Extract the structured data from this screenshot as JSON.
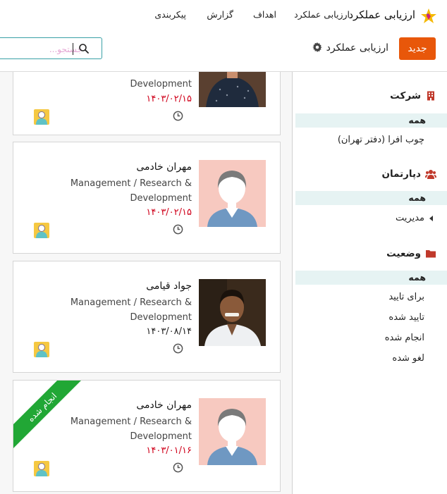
{
  "navbar": {
    "app_title": "ارزیابی عملکرد",
    "menu": [
      {
        "label": "ارزیابی عملکرد"
      },
      {
        "label": "اهداف"
      },
      {
        "label": "گزارش"
      },
      {
        "label": "پیکربندی"
      }
    ]
  },
  "control_panel": {
    "new_button": "جدید",
    "breadcrumb": "ارزیابی عملکرد",
    "search_placeholder": "جستجو..."
  },
  "cards": [
    {
      "name": "",
      "department": "Development",
      "date": "۱۴۰۳/۰۲/۱۵",
      "date_color": "#d0021b",
      "photo": "man-dark-shirt"
    },
    {
      "name": "مهران خادمی",
      "department": "Management / Research & Development",
      "date": "۱۴۰۳/۰۲/۱۵",
      "date_color": "#d0021b",
      "photo": "placeholder"
    },
    {
      "name": "جواد قیامی",
      "department": "Management / Research & Development",
      "date": "۱۴۰۳/۰۸/۱۴",
      "date_color": "#222222",
      "photo": "man-photo"
    },
    {
      "name": "مهران خادمی",
      "department": "Management / Research & Development",
      "date": "۱۴۰۳/۰۱/۱۶",
      "date_color": "#d0021b",
      "photo": "placeholder",
      "ribbon": "انجام شده"
    }
  ],
  "side_panel": {
    "company": {
      "title": "شرکت",
      "all": "همه",
      "items": [
        "چوب افرا (دفتر تهران)"
      ]
    },
    "department": {
      "title": "دپارتمان",
      "all": "همه",
      "items": [
        "مدیریت"
      ]
    },
    "status": {
      "title": "وضعیت",
      "all": "همه",
      "items": [
        "برای تایید",
        "تایید شده",
        "انجام شده",
        "لغو شده"
      ]
    }
  },
  "colors": {
    "accent": "#e8570a",
    "ribbon": "#21a735",
    "overdue_date": "#d0021b",
    "filter_highlight": "#e6f3f3"
  }
}
